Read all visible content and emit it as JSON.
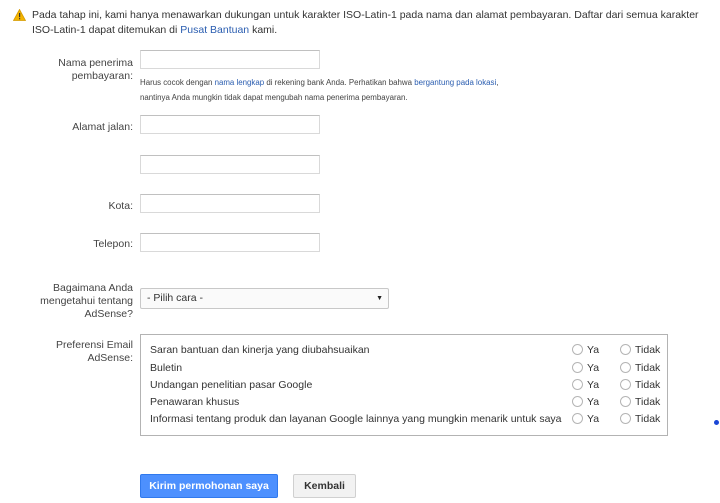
{
  "notice": {
    "text_before": "Pada tahap ini, kami hanya menawarkan dukungan untuk karakter ISO-Latin-1 pada nama dan alamat pembayaran. Daftar dari semua karakter ISO-Latin-1 dapat ditemukan di ",
    "link": "Pusat Bantuan",
    "text_after": " kami."
  },
  "payee": {
    "label_line1": "Nama penerima",
    "label_line2": "pembayaran:",
    "value": "",
    "hint": {
      "t1": "Harus cocok dengan ",
      "link1": "nama lengkap",
      "t2": " di rekening bank Anda. Perhatikan bahwa ",
      "link2": "bergantung pada lokasi",
      "t3": ",",
      "t4": "nantinya Anda mungkin tidak dapat mengubah nama penerima pembayaran."
    }
  },
  "street": {
    "label": "Alamat jalan:",
    "value1": "",
    "value2": ""
  },
  "city": {
    "label": "Kota:",
    "value": ""
  },
  "phone": {
    "label": "Telepon:",
    "value": ""
  },
  "source": {
    "label_line1": "Bagaimana Anda",
    "label_line2": "mengetahui tentang",
    "label_line3": "AdSense?",
    "selected": "- Pilih cara -"
  },
  "preferences": {
    "label_line1": "Preferensi Email",
    "label_line2": "AdSense:",
    "yes_label": "Ya",
    "no_label": "Tidak",
    "items": [
      {
        "label": "Saran bantuan dan kinerja yang diubahsuaikan"
      },
      {
        "label": "Buletin"
      },
      {
        "label": "Undangan penelitian pasar Google"
      },
      {
        "label": "Penawaran khusus"
      },
      {
        "label": "Informasi tentang produk dan layanan Google lainnya yang mungkin menarik untuk saya"
      }
    ]
  },
  "buttons": {
    "submit": "Kirim permohonan saya",
    "back": "Kembali"
  },
  "colors": {
    "primary": "#4d90fe",
    "link": "#2a5db0",
    "warning": "#f4b400"
  }
}
